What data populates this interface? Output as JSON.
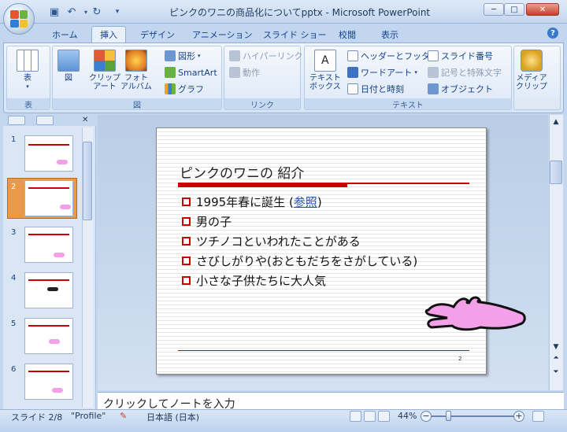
{
  "window": {
    "title": "ピンクのワニの商品化についてpptx - Microsoft PowerPoint"
  },
  "tabs": [
    {
      "label": "ホーム",
      "active": false
    },
    {
      "label": "挿入",
      "active": true
    },
    {
      "label": "デザイン",
      "active": false
    },
    {
      "label": "アニメーション",
      "active": false
    },
    {
      "label": "スライド ショー",
      "active": false
    },
    {
      "label": "校閲",
      "active": false
    },
    {
      "label": "表示",
      "active": false
    }
  ],
  "ribbon": {
    "table_group": {
      "label": "表",
      "button": "表"
    },
    "illust_group": {
      "label": "図",
      "picture": "図",
      "clipart_1": "クリップ",
      "clipart_2": "アート",
      "album_1": "フォト",
      "album_2": "アルバム",
      "shapes": "図形",
      "smartart": "SmartArt",
      "chart": "グラフ"
    },
    "link_group": {
      "label": "リンク",
      "hyperlink": "ハイパーリンク",
      "action": "動作"
    },
    "text_group": {
      "label": "テキスト",
      "textbox_1": "テキスト",
      "textbox_2": "ボックス",
      "header": "ヘッダーとフッター",
      "wordart": "ワードアート",
      "datetime": "日付と時刻",
      "slidenum": "スライド番号",
      "symbol": "記号と特殊文字",
      "object": "オブジェクト"
    },
    "media_group": {
      "media_1": "メディア",
      "media_2": "クリップ"
    }
  },
  "thumbnails": [
    "1",
    "2",
    "3",
    "4",
    "5",
    "6"
  ],
  "slide": {
    "title": "ピンクのワニの 紹介",
    "bullets": [
      {
        "pre": "1995年春に誕生 (",
        "link": "参照",
        "post": ")"
      },
      {
        "pre": "男の子"
      },
      {
        "pre": "ツチノコといわれたことがある"
      },
      {
        "pre": "さびしがりや(おともだちをさがしている)"
      },
      {
        "pre": "小さな子供たちに大人気"
      }
    ],
    "page_number": "2"
  },
  "notes": {
    "placeholder": "クリックしてノートを入力"
  },
  "status": {
    "slide": "スライド 2/8",
    "theme": "\"Profile\"",
    "language": "日本語 (日本)",
    "zoom": "44%"
  },
  "colors": {
    "accent": "#c00000",
    "croc": "#f3a0e8"
  }
}
